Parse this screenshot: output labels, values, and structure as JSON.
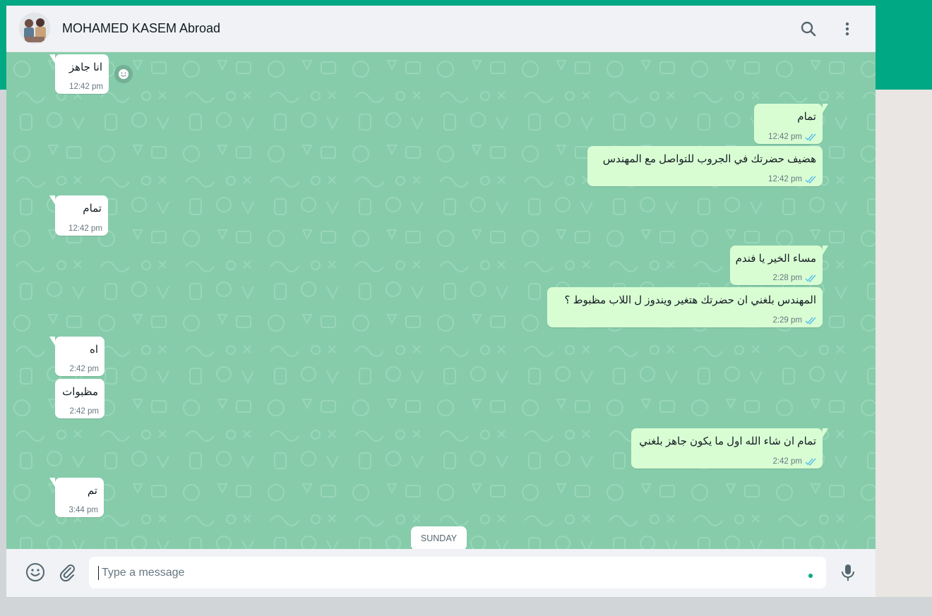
{
  "window": {
    "accent_color": "#00a884"
  },
  "header": {
    "contact_name": "MOHAMED KASEM Abroad",
    "icons": {
      "search": "search-icon",
      "menu": "menu-icon"
    }
  },
  "chat": {
    "incoming_color": "#ffffff",
    "outgoing_color": "#d9fdd3",
    "messages": [
      {
        "direction": "in",
        "text": "انا جاهز",
        "time": "12:42 pm"
      },
      {
        "direction": "out",
        "text": "تمام",
        "time": "12:42 pm"
      },
      {
        "direction": "out",
        "text": "هضيف حضرتك في الجروب للتواصل مع المهندس",
        "time": "12:42 pm"
      },
      {
        "direction": "in",
        "text": "تمام",
        "time": "12:42 pm"
      },
      {
        "direction": "out",
        "text": "مساء الخير يا فندم",
        "time": "2:28 pm"
      },
      {
        "direction": "out",
        "text": "المهندس بلغني ان حضرتك هتغير ويندوز ل اللاب مظبوط ؟",
        "time": "2:29 pm"
      },
      {
        "direction": "in",
        "text": "اه",
        "time": "2:42 pm"
      },
      {
        "direction": "in",
        "text": "مظبوات",
        "time": "2:42 pm"
      },
      {
        "direction": "out",
        "text": "تمام ان شاء الله اول ما يكون جاهز بلغني",
        "time": "2:42 pm"
      },
      {
        "direction": "in",
        "text": "تم",
        "time": "3:44 pm"
      }
    ],
    "date_divider": "SUNDAY"
  },
  "footer": {
    "placeholder": "Type a message",
    "icons": {
      "emoji": "emoji-icon",
      "attach": "paperclip-icon",
      "mic": "microphone-icon"
    }
  }
}
